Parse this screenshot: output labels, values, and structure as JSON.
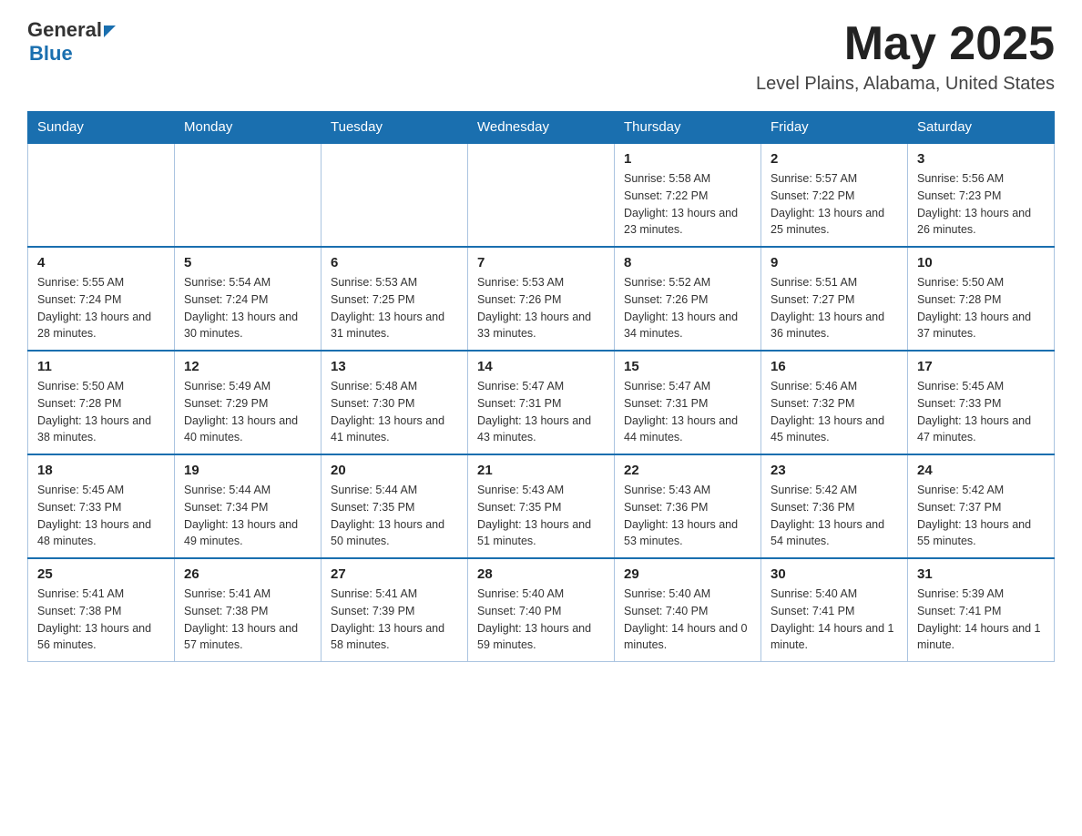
{
  "header": {
    "logo_text_general": "General",
    "logo_text_blue": "Blue",
    "month_title": "May 2025",
    "location": "Level Plains, Alabama, United States"
  },
  "days_of_week": [
    "Sunday",
    "Monday",
    "Tuesday",
    "Wednesday",
    "Thursday",
    "Friday",
    "Saturday"
  ],
  "weeks": [
    [
      {
        "day": "",
        "sunrise": "",
        "sunset": "",
        "daylight": ""
      },
      {
        "day": "",
        "sunrise": "",
        "sunset": "",
        "daylight": ""
      },
      {
        "day": "",
        "sunrise": "",
        "sunset": "",
        "daylight": ""
      },
      {
        "day": "",
        "sunrise": "",
        "sunset": "",
        "daylight": ""
      },
      {
        "day": "1",
        "sunrise": "Sunrise: 5:58 AM",
        "sunset": "Sunset: 7:22 PM",
        "daylight": "Daylight: 13 hours and 23 minutes."
      },
      {
        "day": "2",
        "sunrise": "Sunrise: 5:57 AM",
        "sunset": "Sunset: 7:22 PM",
        "daylight": "Daylight: 13 hours and 25 minutes."
      },
      {
        "day": "3",
        "sunrise": "Sunrise: 5:56 AM",
        "sunset": "Sunset: 7:23 PM",
        "daylight": "Daylight: 13 hours and 26 minutes."
      }
    ],
    [
      {
        "day": "4",
        "sunrise": "Sunrise: 5:55 AM",
        "sunset": "Sunset: 7:24 PM",
        "daylight": "Daylight: 13 hours and 28 minutes."
      },
      {
        "day": "5",
        "sunrise": "Sunrise: 5:54 AM",
        "sunset": "Sunset: 7:24 PM",
        "daylight": "Daylight: 13 hours and 30 minutes."
      },
      {
        "day": "6",
        "sunrise": "Sunrise: 5:53 AM",
        "sunset": "Sunset: 7:25 PM",
        "daylight": "Daylight: 13 hours and 31 minutes."
      },
      {
        "day": "7",
        "sunrise": "Sunrise: 5:53 AM",
        "sunset": "Sunset: 7:26 PM",
        "daylight": "Daylight: 13 hours and 33 minutes."
      },
      {
        "day": "8",
        "sunrise": "Sunrise: 5:52 AM",
        "sunset": "Sunset: 7:26 PM",
        "daylight": "Daylight: 13 hours and 34 minutes."
      },
      {
        "day": "9",
        "sunrise": "Sunrise: 5:51 AM",
        "sunset": "Sunset: 7:27 PM",
        "daylight": "Daylight: 13 hours and 36 minutes."
      },
      {
        "day": "10",
        "sunrise": "Sunrise: 5:50 AM",
        "sunset": "Sunset: 7:28 PM",
        "daylight": "Daylight: 13 hours and 37 minutes."
      }
    ],
    [
      {
        "day": "11",
        "sunrise": "Sunrise: 5:50 AM",
        "sunset": "Sunset: 7:28 PM",
        "daylight": "Daylight: 13 hours and 38 minutes."
      },
      {
        "day": "12",
        "sunrise": "Sunrise: 5:49 AM",
        "sunset": "Sunset: 7:29 PM",
        "daylight": "Daylight: 13 hours and 40 minutes."
      },
      {
        "day": "13",
        "sunrise": "Sunrise: 5:48 AM",
        "sunset": "Sunset: 7:30 PM",
        "daylight": "Daylight: 13 hours and 41 minutes."
      },
      {
        "day": "14",
        "sunrise": "Sunrise: 5:47 AM",
        "sunset": "Sunset: 7:31 PM",
        "daylight": "Daylight: 13 hours and 43 minutes."
      },
      {
        "day": "15",
        "sunrise": "Sunrise: 5:47 AM",
        "sunset": "Sunset: 7:31 PM",
        "daylight": "Daylight: 13 hours and 44 minutes."
      },
      {
        "day": "16",
        "sunrise": "Sunrise: 5:46 AM",
        "sunset": "Sunset: 7:32 PM",
        "daylight": "Daylight: 13 hours and 45 minutes."
      },
      {
        "day": "17",
        "sunrise": "Sunrise: 5:45 AM",
        "sunset": "Sunset: 7:33 PM",
        "daylight": "Daylight: 13 hours and 47 minutes."
      }
    ],
    [
      {
        "day": "18",
        "sunrise": "Sunrise: 5:45 AM",
        "sunset": "Sunset: 7:33 PM",
        "daylight": "Daylight: 13 hours and 48 minutes."
      },
      {
        "day": "19",
        "sunrise": "Sunrise: 5:44 AM",
        "sunset": "Sunset: 7:34 PM",
        "daylight": "Daylight: 13 hours and 49 minutes."
      },
      {
        "day": "20",
        "sunrise": "Sunrise: 5:44 AM",
        "sunset": "Sunset: 7:35 PM",
        "daylight": "Daylight: 13 hours and 50 minutes."
      },
      {
        "day": "21",
        "sunrise": "Sunrise: 5:43 AM",
        "sunset": "Sunset: 7:35 PM",
        "daylight": "Daylight: 13 hours and 51 minutes."
      },
      {
        "day": "22",
        "sunrise": "Sunrise: 5:43 AM",
        "sunset": "Sunset: 7:36 PM",
        "daylight": "Daylight: 13 hours and 53 minutes."
      },
      {
        "day": "23",
        "sunrise": "Sunrise: 5:42 AM",
        "sunset": "Sunset: 7:36 PM",
        "daylight": "Daylight: 13 hours and 54 minutes."
      },
      {
        "day": "24",
        "sunrise": "Sunrise: 5:42 AM",
        "sunset": "Sunset: 7:37 PM",
        "daylight": "Daylight: 13 hours and 55 minutes."
      }
    ],
    [
      {
        "day": "25",
        "sunrise": "Sunrise: 5:41 AM",
        "sunset": "Sunset: 7:38 PM",
        "daylight": "Daylight: 13 hours and 56 minutes."
      },
      {
        "day": "26",
        "sunrise": "Sunrise: 5:41 AM",
        "sunset": "Sunset: 7:38 PM",
        "daylight": "Daylight: 13 hours and 57 minutes."
      },
      {
        "day": "27",
        "sunrise": "Sunrise: 5:41 AM",
        "sunset": "Sunset: 7:39 PM",
        "daylight": "Daylight: 13 hours and 58 minutes."
      },
      {
        "day": "28",
        "sunrise": "Sunrise: 5:40 AM",
        "sunset": "Sunset: 7:40 PM",
        "daylight": "Daylight: 13 hours and 59 minutes."
      },
      {
        "day": "29",
        "sunrise": "Sunrise: 5:40 AM",
        "sunset": "Sunset: 7:40 PM",
        "daylight": "Daylight: 14 hours and 0 minutes."
      },
      {
        "day": "30",
        "sunrise": "Sunrise: 5:40 AM",
        "sunset": "Sunset: 7:41 PM",
        "daylight": "Daylight: 14 hours and 1 minute."
      },
      {
        "day": "31",
        "sunrise": "Sunrise: 5:39 AM",
        "sunset": "Sunset: 7:41 PM",
        "daylight": "Daylight: 14 hours and 1 minute."
      }
    ]
  ]
}
